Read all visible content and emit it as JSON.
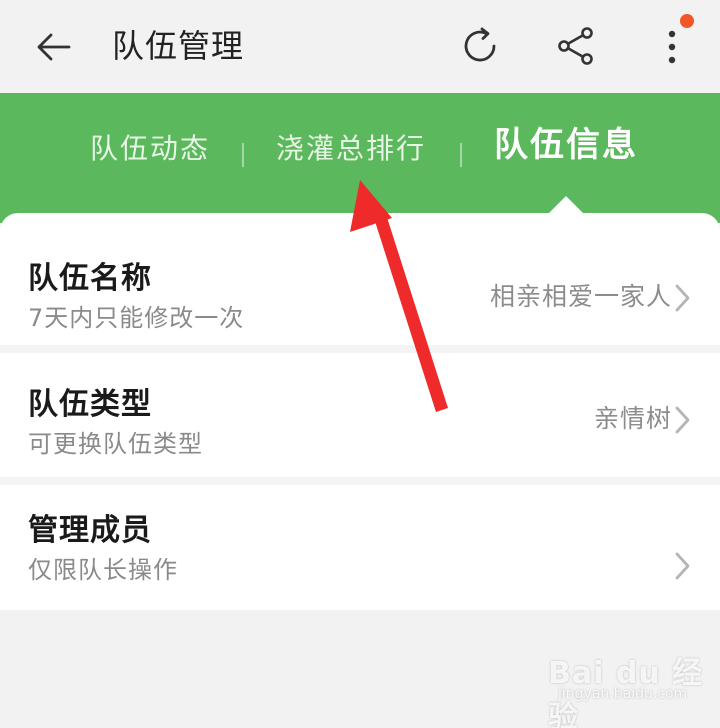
{
  "header": {
    "title": "队伍管理",
    "back_icon": "back-arrow-icon",
    "refresh_icon": "refresh-icon",
    "share_icon": "share-icon",
    "more_icon": "more-vertical-icon"
  },
  "tabs": [
    {
      "label": "队伍动态",
      "active": false
    },
    {
      "label": "浇灌总排行",
      "active": false
    },
    {
      "label": "队伍信息",
      "active": true
    }
  ],
  "rows": [
    {
      "title": "队伍名称",
      "subtitle": "7天内只能修改一次",
      "value": "相亲相爱一家人"
    },
    {
      "title": "队伍类型",
      "subtitle": "可更换队伍类型",
      "value": "亲情树"
    },
    {
      "title": "管理成员",
      "subtitle": "仅限队长操作",
      "value": ""
    }
  ],
  "watermark": {
    "text": "Bai du 经验",
    "url": "jingyan.baidu.com"
  },
  "colors": {
    "background": "#f2f2f2",
    "brand_green": "#5cb85c",
    "notify_dot": "#f0582a",
    "annotation_arrow": "#ee2a2a",
    "chevron": "#b5b5b5"
  }
}
